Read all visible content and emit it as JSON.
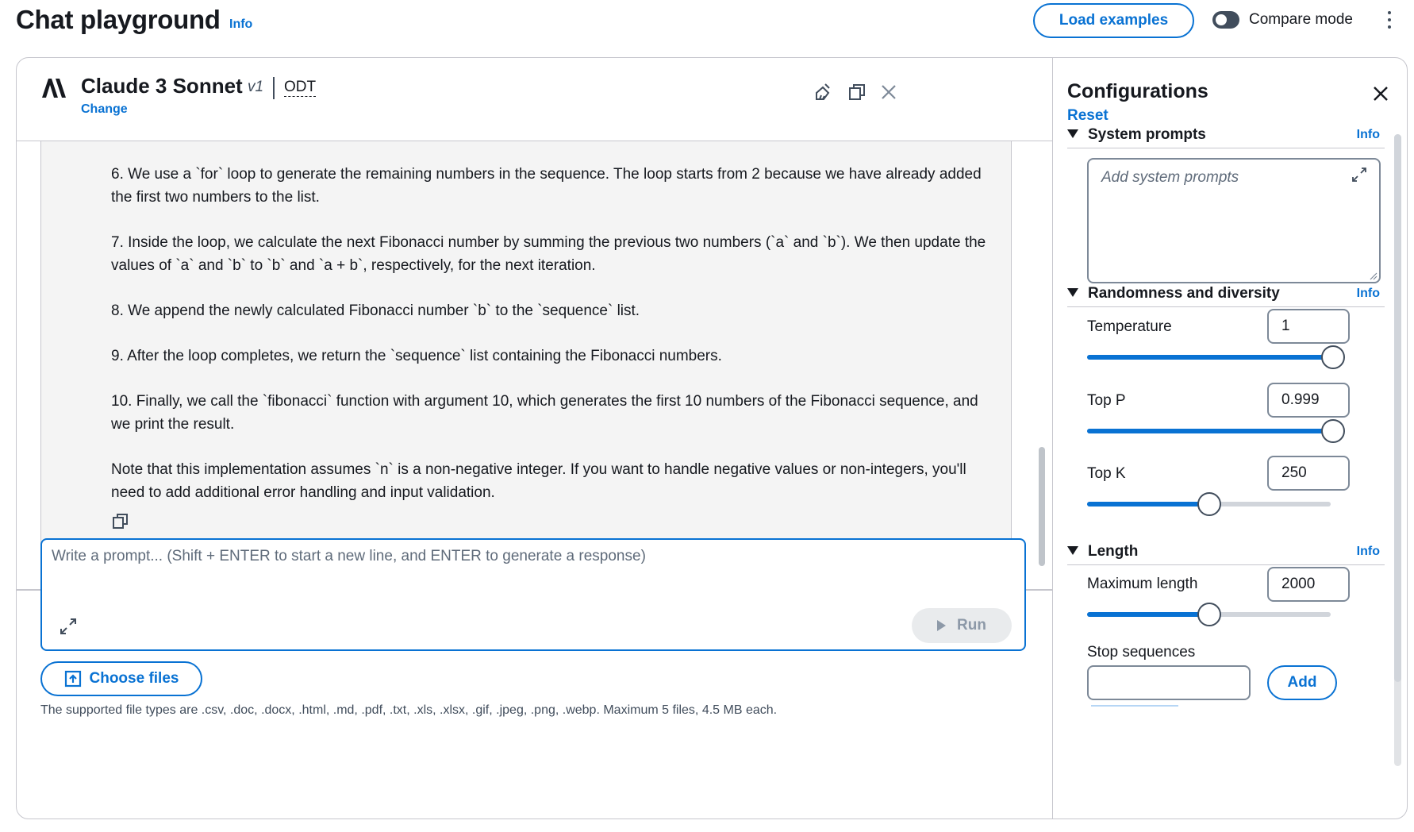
{
  "header": {
    "title": "Chat playground",
    "info_link": "Info",
    "load_examples": "Load examples",
    "compare_mode": "Compare mode"
  },
  "model": {
    "name": "Claude 3 Sonnet",
    "version": "v1",
    "throughput": "ODT",
    "change": "Change"
  },
  "response": {
    "paragraphs": [
      "6. We use a `for` loop to generate the remaining numbers in the sequence. The loop starts from 2 because we have already added the first two numbers to the list.",
      "7. Inside the loop, we calculate the next Fibonacci number by summing the previous two numbers (`a` and `b`). We then update the values of `a` and `b` to `b` and `a + b`, respectively, for the next iteration.",
      "8. We append the newly calculated Fibonacci number `b` to the `sequence` list.",
      "9. After the loop completes, we return the `sequence` list containing the Fibonacci numbers.",
      "10. Finally, we call the `fibonacci` function with argument 10, which generates the first 10 numbers of the Fibonacci sequence, and we print the result.",
      "Note that this implementation assumes `n` is a non-negative integer. If you want to handle negative values or non-integers, you'll need to add additional error handling and input validation."
    ]
  },
  "composer": {
    "placeholder": "Write a prompt... (Shift + ENTER to start a new line, and ENTER to generate a response)",
    "run": "Run",
    "choose_files": "Choose files",
    "file_hint": "The supported file types are .csv, .doc, .docx, .html, .md, .pdf, .txt, .xls, .xlsx, .gif, .jpeg, .png, .webp. Maximum 5 files, 4.5 MB each."
  },
  "config": {
    "title": "Configurations",
    "reset": "Reset",
    "system_prompts": {
      "label": "System prompts",
      "info": "Info",
      "placeholder": "Add system prompts"
    },
    "randomness": {
      "label": "Randomness and diversity",
      "info": "Info",
      "temperature": {
        "label": "Temperature",
        "value": "1",
        "fraction": 1.0
      },
      "top_p": {
        "label": "Top P",
        "value": "0.999",
        "fraction": 0.999
      },
      "top_k": {
        "label": "Top K",
        "value": "250",
        "fraction": 0.5
      }
    },
    "length": {
      "label": "Length",
      "info": "Info",
      "max_length": {
        "label": "Maximum length",
        "value": "2000",
        "fraction": 0.5
      },
      "stop_sequences": {
        "label": "Stop sequences",
        "add": "Add"
      }
    }
  },
  "colors": {
    "accent": "#0972d3",
    "border": "#c6c6cd",
    "text": "#16191f",
    "muted": "#5f6b7a",
    "card_bg": "#f4f4f4"
  },
  "icons": [
    "anthropic-logo-icon",
    "clear-conversation-icon",
    "copy-icon",
    "close-icon",
    "expand-icon",
    "play-icon",
    "upload-icon",
    "caret-down-icon",
    "kebab-menu-icon"
  ]
}
